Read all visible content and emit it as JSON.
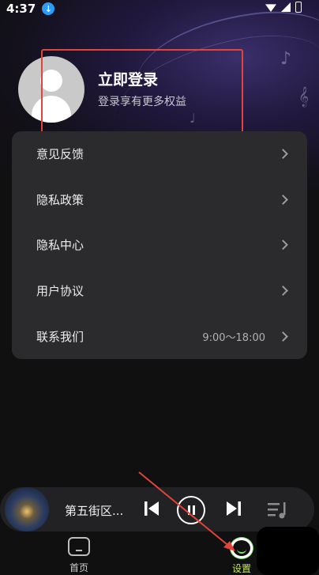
{
  "status_bar": {
    "time": "4:37",
    "download_icon": "download-icon"
  },
  "profile": {
    "title": "立即登录",
    "subtitle": "登录享有更多权益"
  },
  "menu": {
    "items": [
      {
        "label": "意见反馈",
        "extra": ""
      },
      {
        "label": "隐私政策",
        "extra": ""
      },
      {
        "label": "隐私中心",
        "extra": ""
      },
      {
        "label": "用户协议",
        "extra": ""
      },
      {
        "label": "联系我们",
        "extra": "9:00～18:00"
      }
    ]
  },
  "player": {
    "track": "第五街区..."
  },
  "nav": {
    "home_label": "首页",
    "settings_label": "设置"
  },
  "colors": {
    "accent_active": "#c6e95a",
    "highlight_box": "#e0443a",
    "card_bg": "#2b2b2d"
  }
}
